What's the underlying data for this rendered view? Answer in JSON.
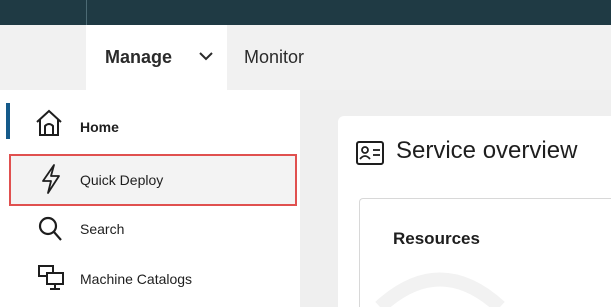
{
  "header": {
    "tabs": [
      {
        "label": "Manage",
        "active": true,
        "has_dropdown": true
      },
      {
        "label": "Monitor",
        "active": false
      }
    ]
  },
  "sidebar": {
    "items": [
      {
        "label": "Home",
        "icon": "home-icon",
        "active": true
      },
      {
        "label": "Quick Deploy",
        "icon": "lightning-icon",
        "highlighted": true
      },
      {
        "label": "Search",
        "icon": "search-icon"
      },
      {
        "label": "Machine Catalogs",
        "icon": "machine-catalogs-icon"
      }
    ]
  },
  "main": {
    "title": "Service overview",
    "title_icon": "id-card-icon",
    "panels": [
      {
        "title": "Resources"
      }
    ]
  },
  "colors": {
    "top_strip": "#1f3a44",
    "active_indicator": "#155a8a",
    "highlight_border": "#e0504f",
    "content_background": "#efefef"
  }
}
